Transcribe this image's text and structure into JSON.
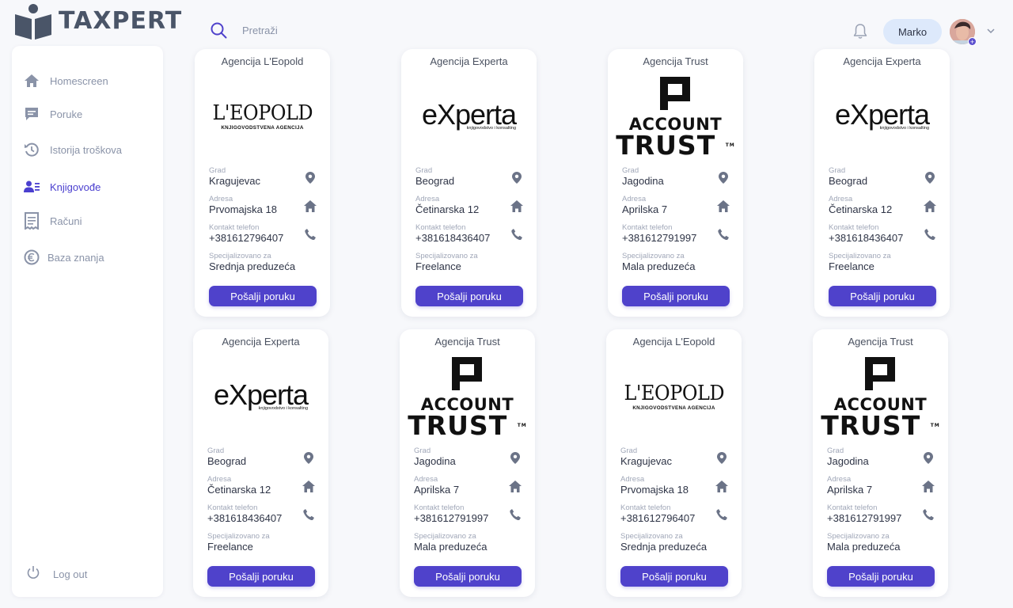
{
  "app": {
    "brand": "TAXPERT"
  },
  "header": {
    "search_placeholder": "Pretraži",
    "user_name": "Marko",
    "search_icon": "search-icon",
    "bell_icon": "bell-icon",
    "chevron_icon": "chevron-down-icon"
  },
  "colors": {
    "accent": "#4f42cb",
    "active_nav": "#4a3fcf",
    "pill": "#dde9fb",
    "muted": "#8a93a8"
  },
  "sidebar": {
    "items": [
      {
        "label": "Homescreen",
        "icon": "home-icon",
        "active": false
      },
      {
        "label": "Poruke",
        "icon": "chat-icon",
        "active": false
      },
      {
        "label": "Istorija troškova",
        "icon": "history-icon",
        "active": false
      },
      {
        "label": "Knjigovođe",
        "icon": "accountants-icon",
        "active": true
      },
      {
        "label": "Računi",
        "icon": "receipt-icon",
        "active": false
      },
      {
        "label": "Baza znanja",
        "icon": "euro-icon",
        "active": false
      }
    ],
    "logout_label": "Log out"
  },
  "labels": {
    "city": "Grad",
    "address": "Adresa",
    "phone": "Kontakt telefon",
    "specialization": "Specijalizovano za",
    "send_button": "Pošalji poruku"
  },
  "logos": {
    "leopold": {
      "main": "L'EOPOLD",
      "sub": "KNJIGOVODSTVENA AGENCIJA"
    },
    "experta": {
      "main": "eXperta",
      "sub": "knjigovodstvo i konsalting"
    },
    "trust": {
      "line1": "ACCOUNT",
      "line2": "TRUST",
      "tm": "TM"
    }
  },
  "cards": [
    {
      "title": "Agencija L'Eopold",
      "logo": "leopold",
      "city": "Kragujevac",
      "address": "Prvomajska 18",
      "phone": "+381612796407",
      "specialization": "Srednja preduzeća"
    },
    {
      "title": "Agencija Experta",
      "logo": "experta",
      "city": "Beograd",
      "address": "Četinarska 12",
      "phone": "+381618436407",
      "specialization": "Freelance"
    },
    {
      "title": "Agencija Trust",
      "logo": "trust",
      "city": "Jagodina",
      "address": "Aprilska 7",
      "phone": "+381612791997",
      "specialization": "Mala preduzeća"
    },
    {
      "title": "Agencija Experta",
      "logo": "experta",
      "city": "Beograd",
      "address": "Četinarska 12",
      "phone": "+381618436407",
      "specialization": "Freelance"
    },
    {
      "title": "Agencija Experta",
      "logo": "experta",
      "city": "Beograd",
      "address": "Četinarska 12",
      "phone": "+381618436407",
      "specialization": "Freelance"
    },
    {
      "title": "Agencija Trust",
      "logo": "trust",
      "city": "Jagodina",
      "address": "Aprilska 7",
      "phone": "+381612791997",
      "specialization": "Mala preduzeća"
    },
    {
      "title": "Agencija L'Eopold",
      "logo": "leopold",
      "city": "Kragujevac",
      "address": "Prvomajska 18",
      "phone": "+381612796407",
      "specialization": "Srednja preduzeća"
    },
    {
      "title": "Agencija Trust",
      "logo": "trust",
      "city": "Jagodina",
      "address": "Aprilska 7",
      "phone": "+381612791997",
      "specialization": "Mala preduzeća"
    }
  ]
}
